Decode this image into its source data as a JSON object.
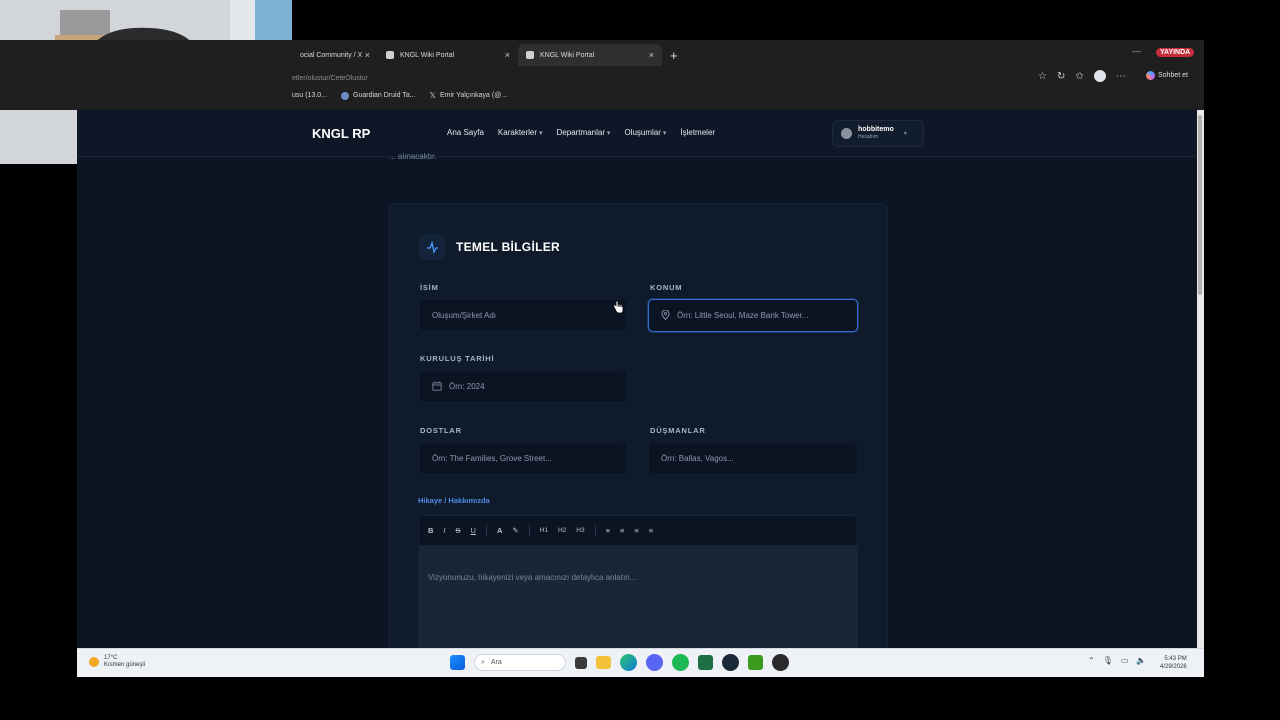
{
  "browser": {
    "tabs": [
      {
        "label": "ocial Community / X"
      },
      {
        "label": "KNGL Wiki Portal"
      },
      {
        "label": "KNGL Wiki Portal"
      }
    ],
    "new_tab": "+",
    "address": "etler/olustur/CeteOlustur",
    "live_badge": "YAYINDA",
    "copilot_label": "Sohbet et",
    "bookmarks": [
      {
        "label": "usu (13.0..."
      },
      {
        "label": "Guardian Druid Ta..."
      },
      {
        "label": "Emir Yalçınkaya (@..."
      }
    ]
  },
  "site": {
    "logo": "KNGL RP",
    "nav": [
      {
        "label": "Ana Sayfa"
      },
      {
        "label": "Karakterler"
      },
      {
        "label": "Departmanlar"
      },
      {
        "label": "Oluşumlar"
      },
      {
        "label": "İşletmeler"
      }
    ],
    "user": {
      "name": "hobbitemo",
      "role": "Hesabım"
    },
    "intro_text": "... alınacaktır."
  },
  "form": {
    "section_title": "TEMEL BİLGİLER",
    "fields": {
      "isim": {
        "label": "İSİM",
        "placeholder": "Oluşum/Şirket Adı"
      },
      "konum": {
        "label": "KONUM",
        "placeholder": "Örn: Little Seoul, Maze Bank Tower..."
      },
      "kurulus": {
        "label": "KURULUŞ TARİHİ",
        "placeholder": "Örn: 2024"
      },
      "dostlar": {
        "label": "DOSTLAR",
        "placeholder": "Örn: The Families, Grove Street..."
      },
      "dusmanlar": {
        "label": "DÜŞMANLAR",
        "placeholder": "Örn: Ballas, Vagos..."
      }
    },
    "story": {
      "label": "Hikaye / Hakkımızda",
      "toolbar": [
        "B",
        "I",
        "S",
        "U",
        "A",
        "H1",
        "H2",
        "H3"
      ],
      "placeholder": "Vizyonunuzu, hikayenizi veya amacınızı detaylıca anlatın..."
    }
  },
  "taskbar": {
    "weather_temp": "17°C",
    "weather_desc": "Kısmen güneşli",
    "search_label": "Ara",
    "time": "5:43 PM",
    "date": "4/29/2026"
  },
  "colors": {
    "accent": "#4a9cff",
    "page_bg": "#0b1524",
    "live": "#c62d3a"
  }
}
